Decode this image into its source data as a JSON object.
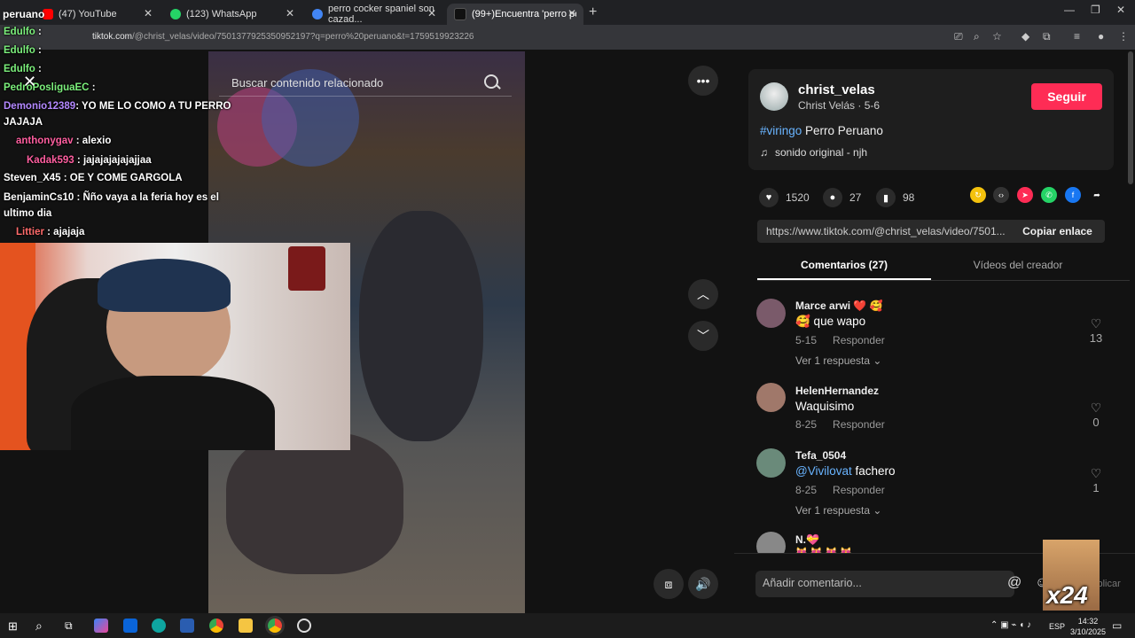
{
  "browser": {
    "tabs": [
      {
        "label": "(47) YouTube",
        "color": "#ff0000"
      },
      {
        "label": "(123) WhatsApp",
        "color": "#25d366"
      },
      {
        "label": "perro cocker spaniel son cazad...",
        "color": "#4285f4"
      },
      {
        "label": "(99+)Encuentra 'perro peruano'",
        "color": "#111111"
      }
    ],
    "url_host": "tiktok.com",
    "url_path": "/@christ_velas/video/7501377925350952197?q=perro%20peruano&t=1759519923226"
  },
  "video": {
    "search_placeholder": "Buscar contenido relacionado"
  },
  "stream": {
    "overlay_title": "peruano",
    "chat": [
      {
        "user": "Edulfo",
        "msg": ":",
        "color": "#7cf07c"
      },
      {
        "user": "Edulfo",
        "msg": ":",
        "color": "#7cf07c"
      },
      {
        "user": "Edulfo",
        "msg": ":",
        "color": "#7cf07c"
      },
      {
        "user": "PedroPosliguaEC",
        "msg": ":",
        "color": "#7cf07c"
      },
      {
        "user": "Demonio12389",
        "msg": ": YO ME LO COMO A TU PERRO",
        "color": "#b388ff"
      },
      {
        "user": "",
        "msg": "JAJAJA",
        "color": "#ffffff"
      },
      {
        "user": "anthonygav",
        "msg": ": alexio",
        "color": "#ff5fa0"
      },
      {
        "user": "Kadak593",
        "msg": ": jajajajajajajjaa",
        "color": "#ff5fa0"
      },
      {
        "user": "Steven_X45",
        "msg": ": OE Y COME GARGOLA",
        "color": "#ffffff"
      },
      {
        "user": "BenjaminCs10",
        "msg": ": Ñño vaya a la feria hoy es el",
        "color": "#ffffff"
      },
      {
        "user": "",
        "msg": "ultimo dia",
        "color": "#ffffff"
      },
      {
        "user": "Littier",
        "msg": ": ajajaja",
        "color": "#ff6b6b"
      }
    ]
  },
  "author": {
    "username": "christ_velas",
    "name_line": "Christ Velás · 5-6",
    "follow_label": "Seguir"
  },
  "description": {
    "hashtag": "#viringo",
    "text": " Perro Peruano"
  },
  "sound": {
    "icon": "♫",
    "label": "sonido original - njh"
  },
  "stats": {
    "likes": "1520",
    "comments": "27",
    "saves": "98"
  },
  "link": {
    "url": "https://www.tiktok.com/@christ_velas/video/7501...",
    "copy_label": "Copiar enlace"
  },
  "tabs": {
    "comments": "Comentarios (27)",
    "creator_videos": "Vídeos del creador"
  },
  "comments": [
    {
      "user": "Marce arwi ❤️ 🥰",
      "text": "🥰 que wapo",
      "date": "5-15",
      "reply": "Responder",
      "likes": "13",
      "replies": "Ver 1 respuesta ⌄",
      "avatar": "#7a5a6a"
    },
    {
      "user": "HelenHernandez",
      "text": "Waquisimo",
      "date": "8-25",
      "reply": "Responder",
      "likes": "0",
      "replies": "",
      "avatar": "#a0786a"
    },
    {
      "user": "Tefa_0504",
      "mention": "@Vivilovat",
      "text": " fachero",
      "date": "8-25",
      "reply": "Responder",
      "likes": "1",
      "replies": "Ver 1 respuesta ⌄",
      "avatar": "#6a8a7a"
    },
    {
      "user": "N.💝",
      "text": "😻 😻 😻 😻",
      "date": "",
      "reply": "",
      "likes": "",
      "replies": "",
      "avatar": "#888888"
    }
  ],
  "comment_bar": {
    "placeholder": "Añadir comentario...",
    "post_label": "Publicar"
  },
  "sticker_text": "x24",
  "taskbar": {
    "lang": "ESP",
    "time": "14:32",
    "date": "3/10/2025"
  }
}
